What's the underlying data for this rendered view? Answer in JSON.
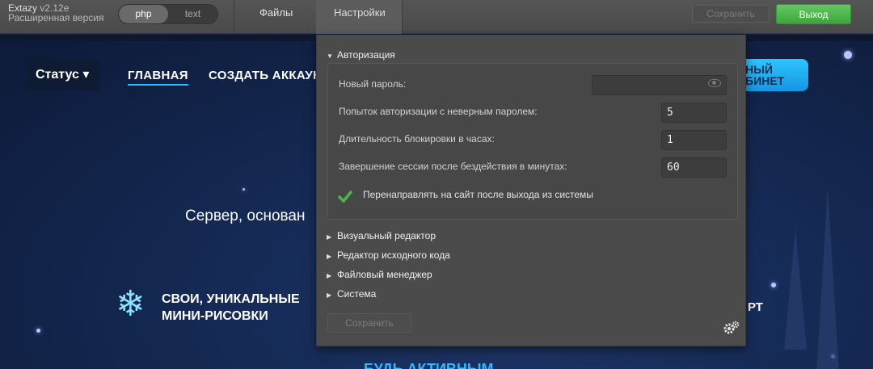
{
  "app": {
    "name": "Extazy",
    "version": "v2.12e",
    "edition": "Расширенная версия"
  },
  "mode_toggle": {
    "options": [
      "php",
      "text"
    ],
    "selected": "php"
  },
  "top_menu": {
    "files": "Файлы",
    "settings": "Настройки"
  },
  "top_buttons": {
    "save": "Сохранить",
    "exit": "Выход"
  },
  "colors": {
    "accent_green": "#4cb64b",
    "panel_bg": "#4b4b4b",
    "site_accent": "#2fb7ff"
  },
  "background_site": {
    "status": "Статус",
    "nav": [
      "ГЛАВНАЯ",
      "СОЗДАТЬ АККАУН"
    ],
    "cabinet": [
      "НЫЙ",
      "БИНЕТ"
    ],
    "server_text": "Сервер, основан",
    "feature": [
      "СВОИ, УНИКАЛЬНЫЕ",
      "МИНИ-РИСОВКИ"
    ],
    "right_fragment": "РТ",
    "bottom_fragment": "БУДЬ АКТИВНЫМ"
  },
  "settings": {
    "auth_section": {
      "title": "Авторизация",
      "expanded": true,
      "new_password": {
        "label": "Новый пароль:",
        "value": ""
      },
      "failed_attempts": {
        "label": "Попыток авторизации с неверным паролем:",
        "value": "5"
      },
      "lock_hours": {
        "label": "Длительность блокировки в часах:",
        "value": "1"
      },
      "session_timeout": {
        "label": "Завершение сессии после бездействия в минутах:",
        "value": "60"
      },
      "redirect_after_logout": {
        "label": "Перенаправлять на сайт после выхода из системы",
        "checked": true
      }
    },
    "collapsed_sections": [
      "Визуальный редактор",
      "Редактор исходного кода",
      "Файловый менеджер",
      "Система"
    ],
    "save_button": "Сохранить"
  }
}
